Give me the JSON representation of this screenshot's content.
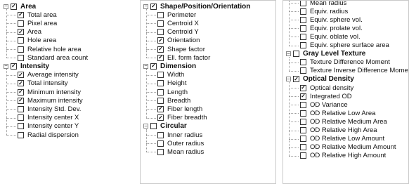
{
  "panels": [
    {
      "categories": [
        {
          "name": "Area",
          "expanded": true,
          "checked": true,
          "items": [
            {
              "label": "Total area",
              "checked": true
            },
            {
              "label": "Pixel area",
              "checked": false
            },
            {
              "label": "Area",
              "checked": true
            },
            {
              "label": "Hole area",
              "checked": false
            },
            {
              "label": "Relative hole area",
              "checked": false
            },
            {
              "label": "Standard area count",
              "checked": false
            }
          ]
        },
        {
          "name": "Intensity",
          "expanded": true,
          "checked": true,
          "items": [
            {
              "label": "Average intensity",
              "checked": true
            },
            {
              "label": "Total intensity",
              "checked": true
            },
            {
              "label": "Minimum intensity",
              "checked": true
            },
            {
              "label": "Maximum intensity",
              "checked": true
            },
            {
              "label": "Intensity Std. Dev.",
              "checked": false
            },
            {
              "label": "Intensity center X",
              "checked": false
            },
            {
              "label": "Intensity center Y",
              "checked": false
            },
            {
              "label": "Radial dispersion",
              "checked": false
            }
          ]
        }
      ]
    },
    {
      "categories": [
        {
          "name": "Shape/Position/Orientation",
          "expanded": true,
          "checked": true,
          "items": [
            {
              "label": "Perimeter",
              "checked": false
            },
            {
              "label": "Centroid X",
              "checked": false
            },
            {
              "label": "Centroid Y",
              "checked": false
            },
            {
              "label": "Orientation",
              "checked": true
            },
            {
              "label": "Shape factor",
              "checked": true
            },
            {
              "label": "Ell. form factor",
              "checked": true
            }
          ]
        },
        {
          "name": "Dimension",
          "expanded": true,
          "checked": true,
          "items": [
            {
              "label": "Width",
              "checked": false
            },
            {
              "label": "Height",
              "checked": false
            },
            {
              "label": "Length",
              "checked": false
            },
            {
              "label": "Breadth",
              "checked": false
            },
            {
              "label": "Fiber length",
              "checked": true
            },
            {
              "label": "Fiber breadth",
              "checked": true
            }
          ]
        },
        {
          "name": "Circular",
          "expanded": true,
          "checked": false,
          "items": [
            {
              "label": "Inner radius",
              "checked": false
            },
            {
              "label": "Outer radius",
              "checked": false
            },
            {
              "label": "Mean radius",
              "checked": false
            }
          ]
        }
      ]
    },
    {
      "categories": [
        {
          "name": "",
          "expanded": true,
          "checked": false,
          "continued": true,
          "items": [
            {
              "label": "Mean radius",
              "checked": false
            },
            {
              "label": "Equiv. radius",
              "checked": false
            },
            {
              "label": "Equiv. sphere vol.",
              "checked": false
            },
            {
              "label": "Equiv. prolate vol.",
              "checked": false
            },
            {
              "label": "Equiv. oblate vol.",
              "checked": false
            },
            {
              "label": "Equiv. sphere surface area",
              "checked": false
            }
          ]
        },
        {
          "name": "Gray Level Texture",
          "expanded": true,
          "checked": false,
          "items": [
            {
              "label": "Texture Difference Moment",
              "checked": false
            },
            {
              "label": "Texture Inverse Difference Moment",
              "checked": false
            }
          ]
        },
        {
          "name": "Optical Density",
          "expanded": true,
          "checked": true,
          "items": [
            {
              "label": "Optical density",
              "checked": true
            },
            {
              "label": "Integrated OD",
              "checked": true
            },
            {
              "label": "OD Variance",
              "checked": false
            },
            {
              "label": "OD Relative Low Area",
              "checked": false
            },
            {
              "label": "OD Relative Medium Area",
              "checked": false
            },
            {
              "label": "OD Relative High Area",
              "checked": false
            },
            {
              "label": "OD Relative Low Amount",
              "checked": false
            },
            {
              "label": "OD Relative Medium Amount",
              "checked": false
            },
            {
              "label": "OD Relative High Amount",
              "checked": false
            }
          ]
        }
      ]
    }
  ]
}
